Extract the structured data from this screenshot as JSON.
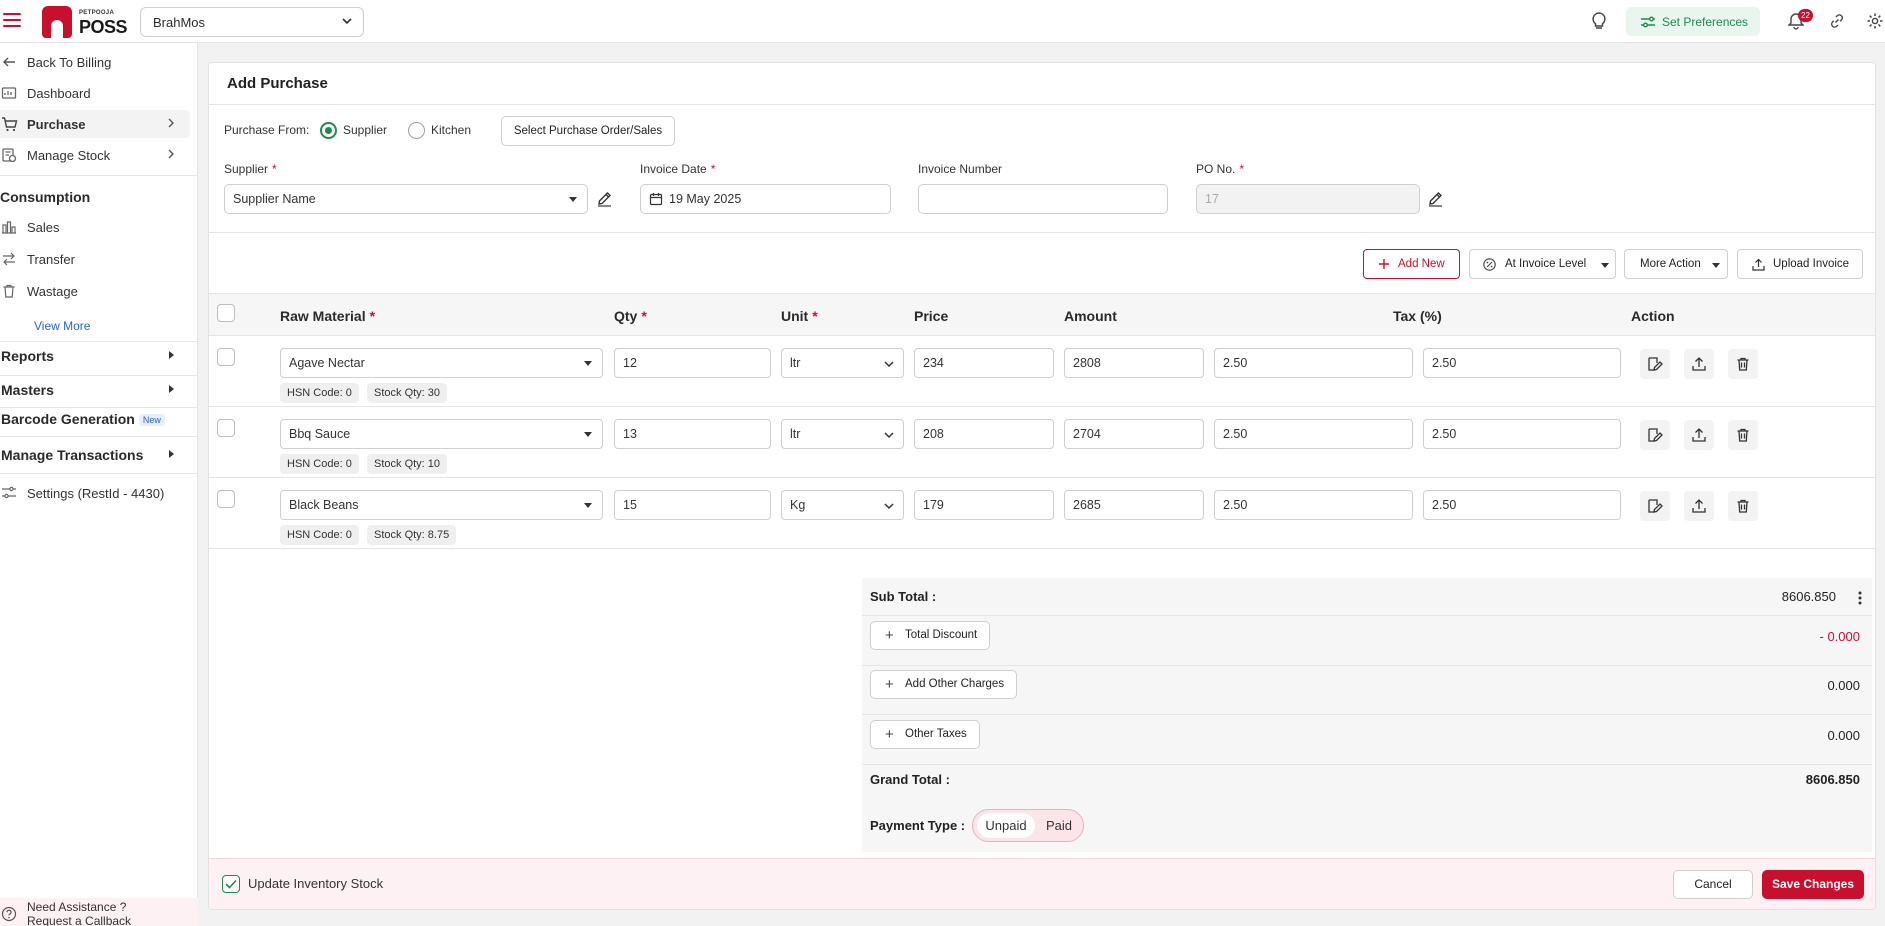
{
  "header": {
    "logo_small": "PETPOOJA",
    "logo_big": "POSS",
    "outlet": "BrahMos",
    "set_preferences": "Set Preferences",
    "notification_count": "22"
  },
  "sidebar": {
    "back": "Back To Billing",
    "dashboard": "Dashboard",
    "purchase": "Purchase",
    "manage_stock": "Manage Stock",
    "consumption": "Consumption",
    "sales": "Sales",
    "transfer": "Transfer",
    "wastage": "Wastage",
    "view_more": "View More",
    "reports": "Reports",
    "masters": "Masters",
    "barcode": "Barcode Generation",
    "new_tag": "New",
    "manage_transactions": "Manage Transactions",
    "settings": "Settings (RestId - 4430)",
    "assist_line1": "Need Assistance ?",
    "assist_line2": "Request a Callback"
  },
  "form": {
    "title": "Add Purchase",
    "purchase_from_label": "Purchase From:",
    "opt_supplier": "Supplier",
    "opt_kitchen": "Kitchen",
    "select_po_button": "Select Purchase Order/Sales",
    "supplier_label": "Supplier",
    "supplier_value": "Supplier Name",
    "invoice_date_label": "Invoice Date",
    "invoice_date_value": "19 May 2025",
    "invoice_number_label": "Invoice Number",
    "invoice_number_value": "",
    "po_label": "PO No.",
    "po_value": "17",
    "required_mark": "*"
  },
  "actions": {
    "add_new": "Add New",
    "invoice_level": "At Invoice Level",
    "more_action": "More Action",
    "upload_invoice": "Upload Invoice"
  },
  "table": {
    "headers": {
      "raw_material": "Raw Material",
      "qty": "Qty",
      "unit": "Unit",
      "price": "Price",
      "amount": "Amount",
      "tax": "Tax (%)",
      "action": "Action"
    },
    "rows": [
      {
        "material": "Agave Nectar",
        "qty": "12",
        "unit": "ltr",
        "price": "234",
        "amount": "2808",
        "tax1": "2.50",
        "tax2": "2.50",
        "hsn": "HSN Code: 0",
        "stock": "Stock Qty: 30"
      },
      {
        "material": "Bbq Sauce",
        "qty": "13",
        "unit": "ltr",
        "price": "208",
        "amount": "2704",
        "tax1": "2.50",
        "tax2": "2.50",
        "hsn": "HSN Code: 0",
        "stock": "Stock Qty: 10"
      },
      {
        "material": "Black Beans",
        "qty": "15",
        "unit": "Kg",
        "price": "179",
        "amount": "2685",
        "tax1": "2.50",
        "tax2": "2.50",
        "hsn": "HSN Code: 0",
        "stock": "Stock Qty: 8.75"
      }
    ]
  },
  "summary": {
    "sub_total_label": "Sub Total :",
    "sub_total": "8606.850",
    "total_discount": "Total Discount",
    "discount_value": "- 0.000",
    "other_charges": "Add Other Charges",
    "other_charges_value": "0.000",
    "other_taxes": "Other Taxes",
    "other_taxes_value": "0.000",
    "grand_total_label": "Grand Total :",
    "grand_total": "8606.850",
    "payment_type_label": "Payment Type :",
    "unpaid": "Unpaid",
    "paid": "Paid"
  },
  "footer": {
    "update_inventory": "Update Inventory Stock",
    "cancel": "Cancel",
    "save": "Save Changes"
  },
  "colors": {
    "brand": "#c8102e",
    "green": "#1e8a4c"
  }
}
